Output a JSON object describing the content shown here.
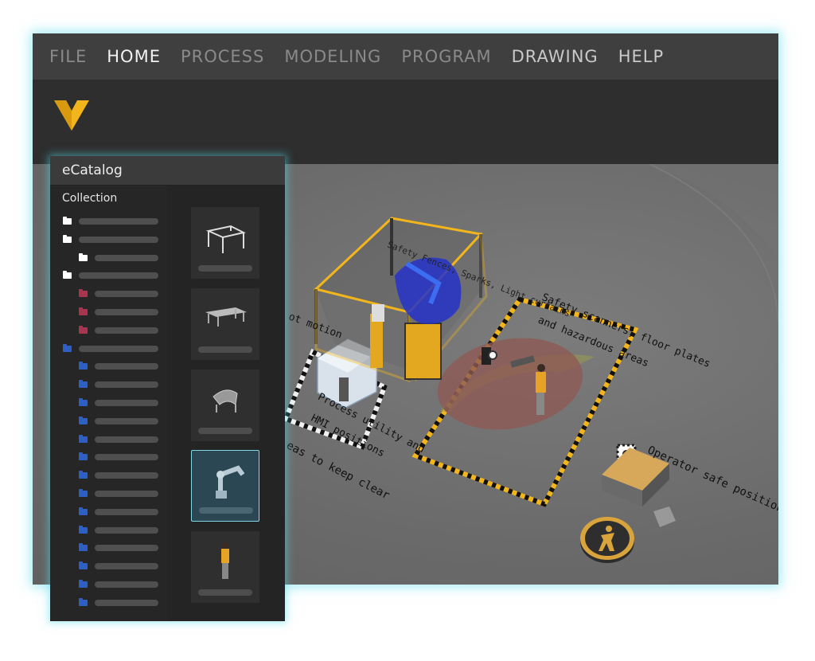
{
  "menu": {
    "items": [
      "FILE",
      "HOME",
      "PROCESS",
      "MODELING",
      "PROGRAM",
      "DRAWING",
      "HELP"
    ],
    "active": "HOME"
  },
  "ecatalog": {
    "title": "eCatalog",
    "collection_label": "Collection"
  },
  "annotations": {
    "fences": "Safety Fences, Sparks, Light curtains",
    "robot_motion": "ot motion",
    "scanners_1": "Safety scanners, floor plates",
    "scanners_2": "and hazardous areas",
    "process_1": "Process utility and",
    "process_2": "HMI positions",
    "keep_clear": "eas to keep clear",
    "operator": "Operator safe positions"
  },
  "colors": {
    "accent_glow": "#5adceb",
    "logo_yellow": "#f2b51c",
    "folder_white": "#ffffff",
    "folder_red": "#a8354f",
    "folder_blue": "#2e5fc4"
  },
  "icons": [
    "logo-icon",
    "folder-icon",
    "operator-icon"
  ]
}
